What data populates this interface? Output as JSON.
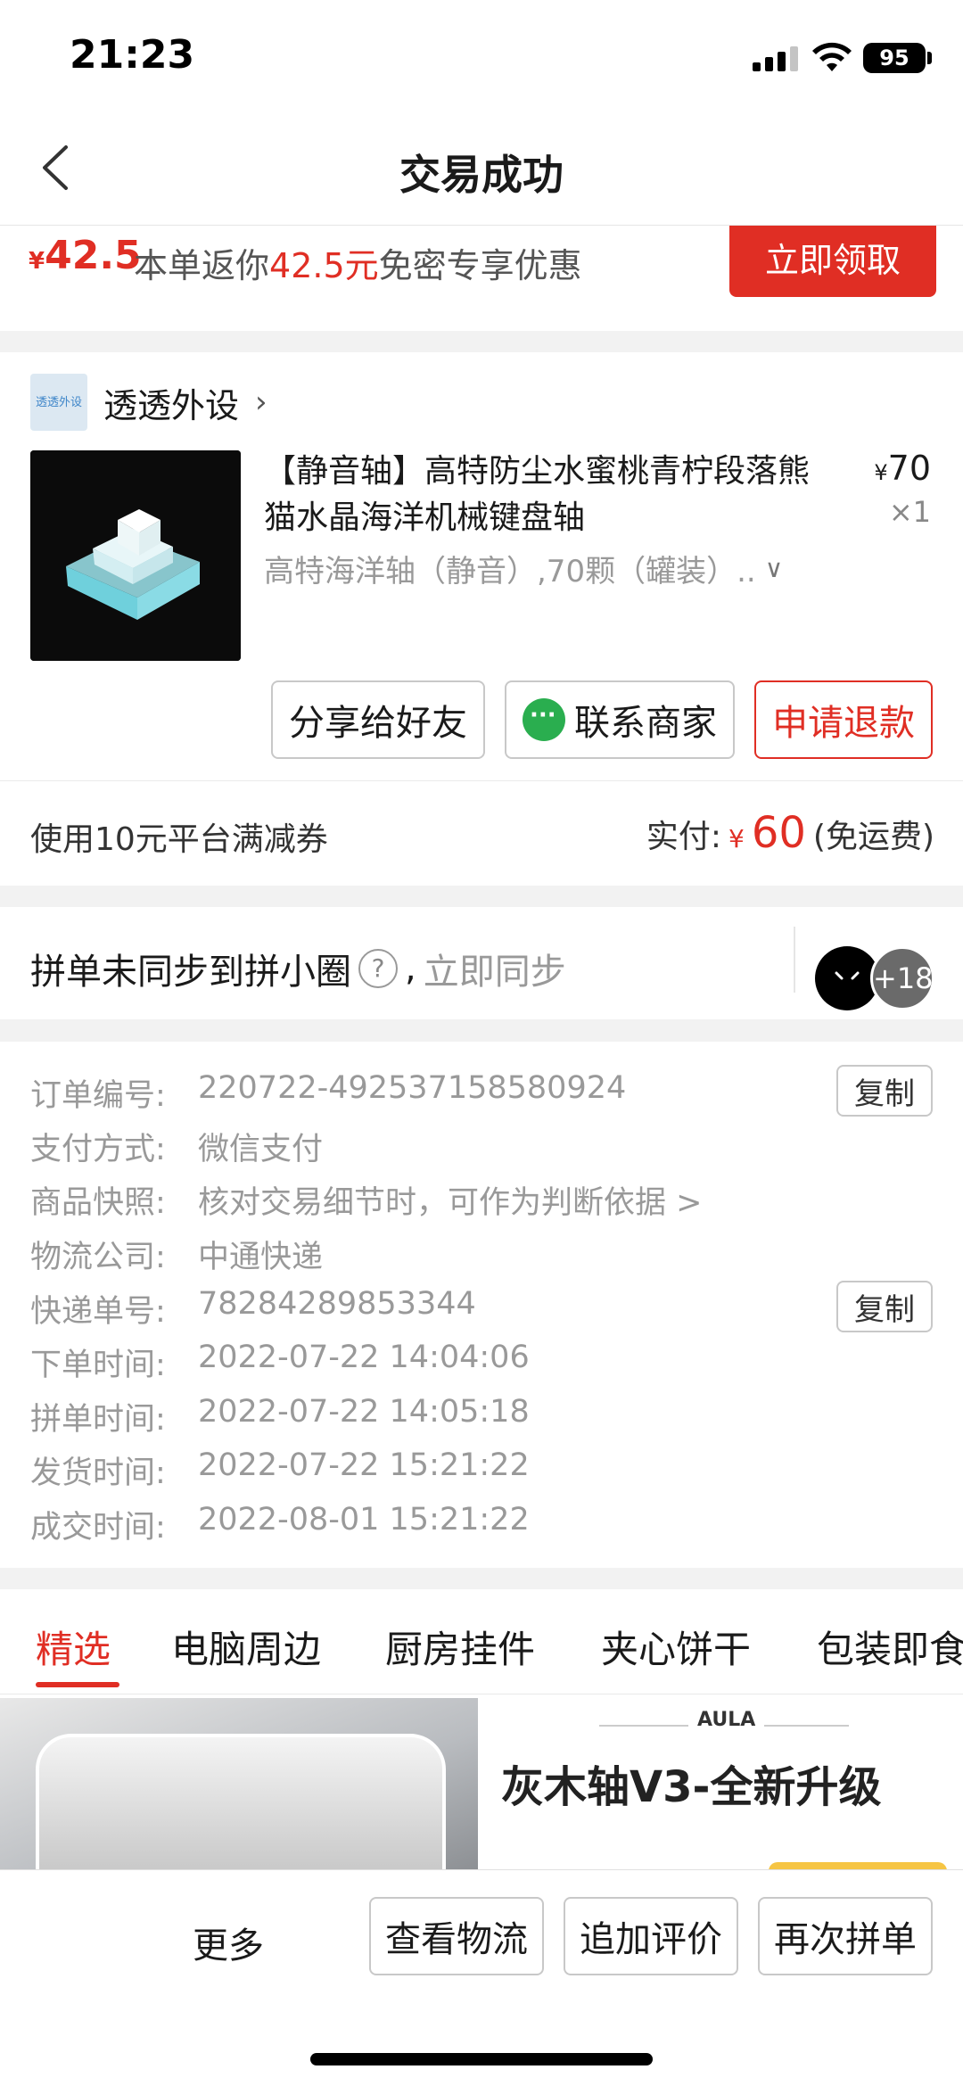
{
  "status_bar": {
    "time": "21:23",
    "battery": "95"
  },
  "nav": {
    "title": "交易成功"
  },
  "promo": {
    "amount": "42.5",
    "currency": "¥",
    "text_before": "本单返你",
    "text_highlight": "42.5元",
    "text_after": "免密专享优惠",
    "button": "立即领取"
  },
  "store": {
    "logo_text": "透透外设",
    "name": "透透外设"
  },
  "product": {
    "title": "【静音轴】高特防尘水蜜桃青柠段落熊猫水晶海洋机械键盘轴",
    "currency": "¥",
    "price": "70",
    "qty": "×1",
    "spec": "高特海洋轴（静音）,70颗（罐装）.."
  },
  "actions": {
    "share": "分享给好友",
    "contact": "联系商家",
    "refund": "申请退款"
  },
  "payment": {
    "coupon": "使用10元平台满减券",
    "paid_label": "实付:",
    "currency": "¥",
    "paid_amount": "60",
    "shipping": "(免运费)"
  },
  "sync": {
    "text": "拼单未同步到拼小圈",
    "comma": ",",
    "link": "立即同步",
    "avatar_count": "+18"
  },
  "order_info": {
    "copy_label": "复制",
    "rows": [
      {
        "label": "订单编号:",
        "value": "220722-492537158580924"
      },
      {
        "label": "支付方式:",
        "value": "微信支付"
      },
      {
        "label": "商品快照:",
        "value": "核对交易细节时，可作为判断依据 >"
      },
      {
        "label": "物流公司:",
        "value": "中通快递"
      },
      {
        "label": "快递单号:",
        "value": "78284289853344"
      },
      {
        "label": "下单时间:",
        "value": "2022-07-22 14:04:06"
      },
      {
        "label": "拼单时间:",
        "value": "2022-07-22 14:05:18"
      },
      {
        "label": "发货时间:",
        "value": "2022-07-22 15:21:22"
      },
      {
        "label": "成交时间:",
        "value": "2022-08-01 15:21:22"
      }
    ]
  },
  "tabs": [
    {
      "label": "精选"
    },
    {
      "label": "电脑周边"
    },
    {
      "label": "厨房挂件"
    },
    {
      "label": "夹心饼干"
    },
    {
      "label": "包装即食"
    }
  ],
  "feed": {
    "brand": "AULA",
    "headline": "灰木轴V3-全新升级"
  },
  "bottom": {
    "more": "更多",
    "logistics": "查看物流",
    "review": "追加评价",
    "rebuy": "再次拼单"
  },
  "colors": {
    "accent": "#e02e24",
    "wechat": "#2aae4f"
  }
}
